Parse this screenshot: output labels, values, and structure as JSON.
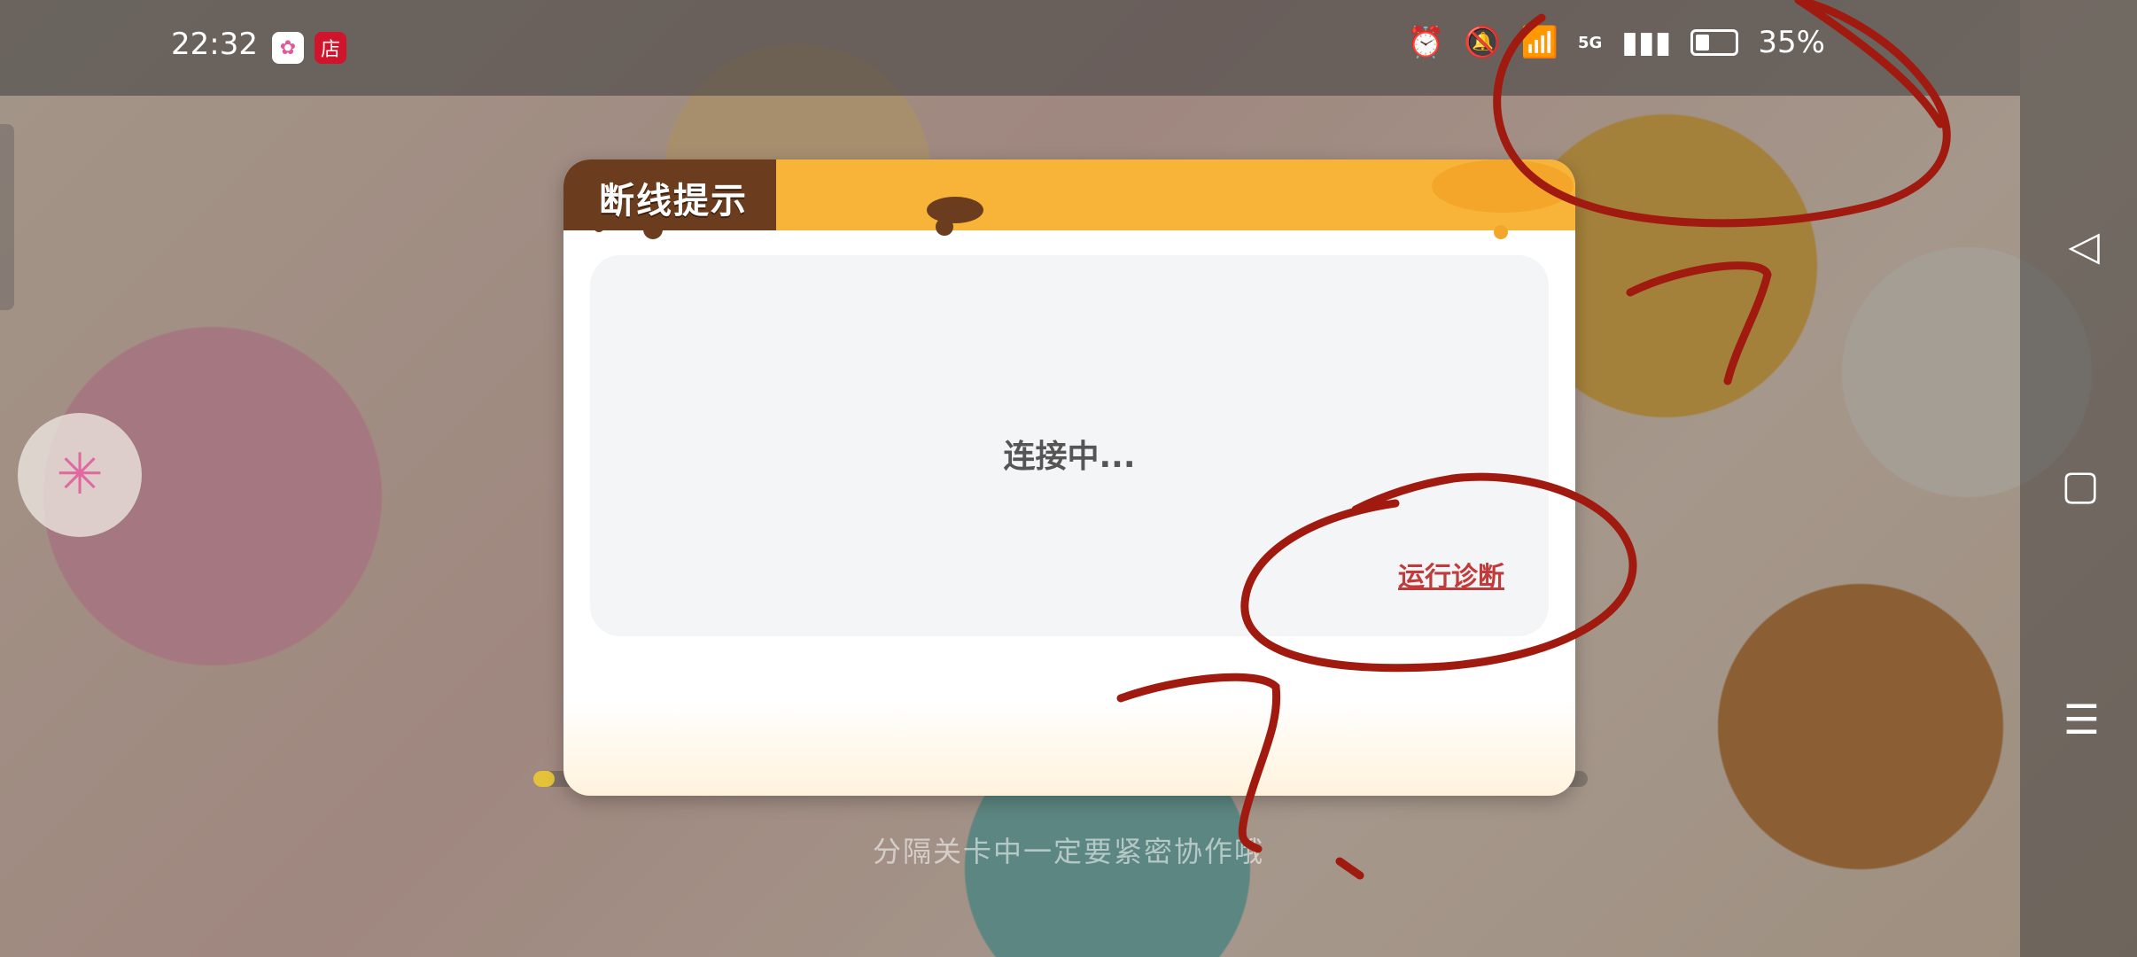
{
  "status_bar": {
    "time": "22:32",
    "store_icon_label": "店",
    "network_label": "5G",
    "battery_percent": "35%",
    "battery_level": 0.35
  },
  "dialog": {
    "title": "断线提示",
    "status": "连接中...",
    "diagnose_link": "运行诊断"
  },
  "loading": {
    "hint": "分隔关卡中一定要紧密协作哦",
    "progress": 0.02
  },
  "annotation": {
    "ink_color": "#a01a10"
  }
}
